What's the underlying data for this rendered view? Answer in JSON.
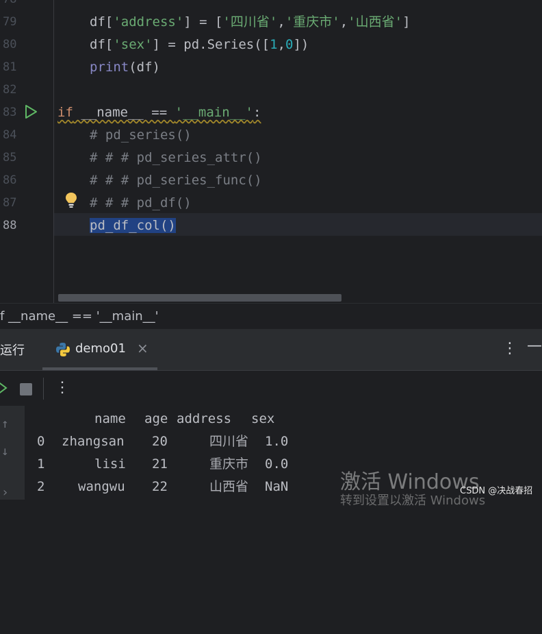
{
  "editor": {
    "lines": [
      {
        "num": "78",
        "text": ""
      },
      {
        "num": "79",
        "text": "df['address'] = ['四川省','重庆市','山西省']"
      },
      {
        "num": "80",
        "text": "df['sex'] = pd.Series([1,0])"
      },
      {
        "num": "81",
        "text": "print(df)"
      },
      {
        "num": "82",
        "text": ""
      },
      {
        "num": "83",
        "text": "if __name__ == '__main__':"
      },
      {
        "num": "84",
        "text": "# pd_series()"
      },
      {
        "num": "85",
        "text": "# # # pd_series_attr()"
      },
      {
        "num": "86",
        "text": "# # # pd_series_func()"
      },
      {
        "num": "87",
        "text": "# # # pd_df()"
      },
      {
        "num": "88",
        "text": "pd_df_col()"
      }
    ],
    "tokens": {
      "l79_df": "df[",
      "l79_key": "'address'",
      "l79_eq": "] = [",
      "l79_s1": "'四川省'",
      "l79_c1": ",",
      "l79_s2": "'重庆市'",
      "l79_c2": ",",
      "l79_s3": "'山西省'",
      "l79_end": "]",
      "l80_df": "df[",
      "l80_key": "'sex'",
      "l80_eq": "] = pd.Series([",
      "l80_n1": "1",
      "l80_c": ",",
      "l80_n2": "0",
      "l80_end": "])",
      "l81_print": "print",
      "l81_rest": "(df)",
      "l83_if": "if",
      "l83_mid": " __name__ == ",
      "l83_str": "'__main__'",
      "l83_colon": ":",
      "l88_call": "pd_df_col()"
    }
  },
  "breadcrumb": {
    "text": "f __name__ == '__main__'"
  },
  "run_panel": {
    "title": "运行",
    "tab_label": "demo01",
    "close_glyph": "×",
    "more_glyph": "⋮",
    "minimize_glyph": "—"
  },
  "toolbar": {
    "more_glyph": "⋮"
  },
  "console": {
    "columns": [
      "name",
      "age",
      "address",
      "sex"
    ],
    "rows": [
      {
        "index": "0",
        "name": "zhangsan",
        "age": "20",
        "address": "四川省",
        "sex": "1.0"
      },
      {
        "index": "1",
        "name": "lisi",
        "age": "21",
        "address": "重庆市",
        "sex": "0.0"
      },
      {
        "index": "2",
        "name": "wangwu",
        "age": "22",
        "address": "山西省",
        "sex": "NaN"
      }
    ]
  },
  "overlay": {
    "activate": "激活 Windows",
    "activate_sub": "转到设置以激活 Windows",
    "csdn": "CSDN @决战春招"
  },
  "colors": {
    "keyword": "#cf8e6d",
    "string": "#6aab73",
    "number": "#2aacb8",
    "comment": "#7a7e85",
    "selection": "#214283"
  }
}
